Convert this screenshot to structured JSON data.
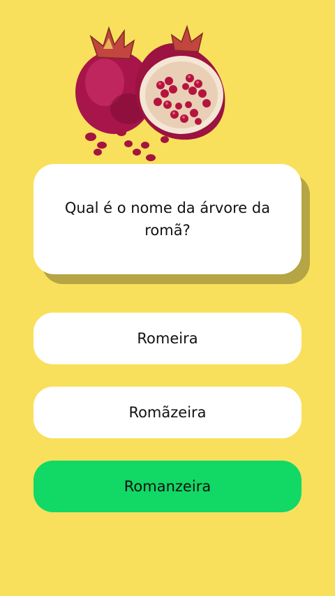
{
  "question": {
    "text": "Qual é o nome da árvore da romã?"
  },
  "answers": [
    {
      "label": "Romeira",
      "state": "default"
    },
    {
      "label": "Romãzeira",
      "state": "default"
    },
    {
      "label": "Romanzeira",
      "state": "correct"
    }
  ],
  "colors": {
    "background": "#F9E05C",
    "card": "#FFFFFF",
    "card_shadow": "#B5A544",
    "correct": "#12D865",
    "text": "#111111"
  },
  "illustration": {
    "icon": "pomegranate-illustration"
  }
}
